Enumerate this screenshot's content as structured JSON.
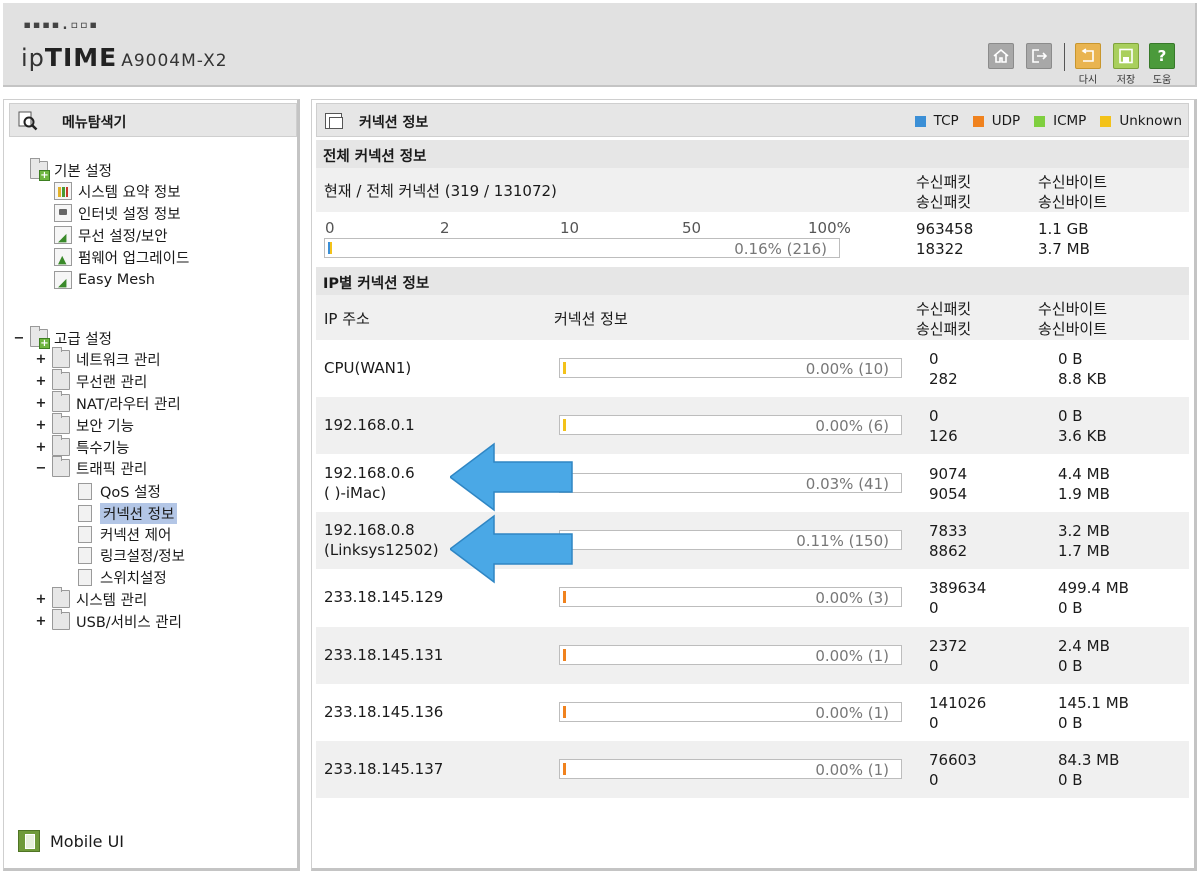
{
  "header": {
    "logo_dots": "▪▪▪▪.▫▫▪",
    "brand_ip": "ip",
    "brand_time": "TIME",
    "model": "A9004M-X2",
    "buttons": {
      "reset": "다시",
      "save": "저장",
      "help": "도움"
    }
  },
  "sidebar": {
    "title": "메뉴탐색기",
    "basic": {
      "label": "기본 설정",
      "items": [
        "시스템 요약 정보",
        "인터넷 설정 정보",
        "무선 설정/보안",
        "펌웨어 업그레이드",
        "Easy Mesh"
      ]
    },
    "advanced": {
      "label": "고급 설정",
      "toggle": "−",
      "items": [
        "네트워크 관리",
        "무선랜 관리",
        "NAT/라우터 관리",
        "보안 기능",
        "특수기능",
        "트래픽 관리",
        "시스템 관리",
        "USB/서비스 관리"
      ],
      "traffic_sub": [
        "QoS 설정",
        "커넥션 정보",
        "커넥션 제어",
        "링크설정/정보",
        "스위치설정"
      ]
    },
    "mobile_ui": "Mobile UI"
  },
  "main": {
    "title": "커넥션 정보",
    "legend": [
      {
        "label": "TCP",
        "color": "#3b8fd6"
      },
      {
        "label": "UDP",
        "color": "#f0821e"
      },
      {
        "label": "ICMP",
        "color": "#7fcf3f"
      },
      {
        "label": "Unknown",
        "color": "#f3c21a"
      }
    ],
    "total": {
      "heading": "전체 커넥션 정보",
      "current_label": "현재 / 전체 커넥션 (319 / 131072)",
      "recv_pkt_label": "수신패킷",
      "send_pkt_label": "송신패킷",
      "recv_byte_label": "수신바이트",
      "send_byte_label": "송신바이트",
      "scale": [
        "0",
        "2",
        "10",
        "50",
        "100%"
      ],
      "bar_text": "0.16% (216)",
      "recv_pkt": "963458",
      "send_pkt": "18322",
      "recv_bytes": "1.1 GB",
      "send_bytes": "3.7 MB"
    },
    "per_ip": {
      "heading": "IP별 커넥션 정보",
      "col_ip": "IP 주소",
      "col_conn": "커넥션 정보",
      "recv_pkt_label": "수신패킷",
      "send_pkt_label": "송신패킷",
      "recv_byte_label": "수신바이트",
      "send_byte_label": "송신바이트",
      "rows": [
        {
          "ip": "CPU(WAN1)",
          "host": "",
          "bar": "0.00% (10)",
          "fill": "#f3c21a",
          "rp": "0",
          "sp": "282",
          "rb": "0 B",
          "sb": "8.8 KB"
        },
        {
          "ip": "192.168.0.1",
          "host": "",
          "bar": "0.00% (6)",
          "fill": "#f3c21a",
          "rp": "0",
          "sp": "126",
          "rb": "0 B",
          "sb": "3.6 KB"
        },
        {
          "ip": "192.168.0.6",
          "host": "(        )-iMac)",
          "bar": "0.03% (41)",
          "fill": "#3b8fd6",
          "rp": "9074",
          "sp": "9054",
          "rb": "4.4 MB",
          "sb": "1.9 MB"
        },
        {
          "ip": "192.168.0.8",
          "host": "(Linksys12502)",
          "bar": "0.11% (150)",
          "fill": "#f3c21a",
          "rp": "7833",
          "sp": "8862",
          "rb": "3.2 MB",
          "sb": "1.7 MB"
        },
        {
          "ip": "233.18.145.129",
          "host": "",
          "bar": "0.00% (3)",
          "fill": "#f0821e",
          "rp": "389634",
          "sp": "0",
          "rb": "499.4 MB",
          "sb": "0 B"
        },
        {
          "ip": "233.18.145.131",
          "host": "",
          "bar": "0.00% (1)",
          "fill": "#f0821e",
          "rp": "2372",
          "sp": "0",
          "rb": "2.4 MB",
          "sb": "0 B"
        },
        {
          "ip": "233.18.145.136",
          "host": "",
          "bar": "0.00% (1)",
          "fill": "#f0821e",
          "rp": "141026",
          "sp": "0",
          "rb": "145.1 MB",
          "sb": "0 B"
        },
        {
          "ip": "233.18.145.137",
          "host": "",
          "bar": "0.00% (1)",
          "fill": "#f0821e",
          "rp": "76603",
          "sp": "0",
          "rb": "84.3 MB",
          "sb": "0 B"
        }
      ]
    }
  }
}
